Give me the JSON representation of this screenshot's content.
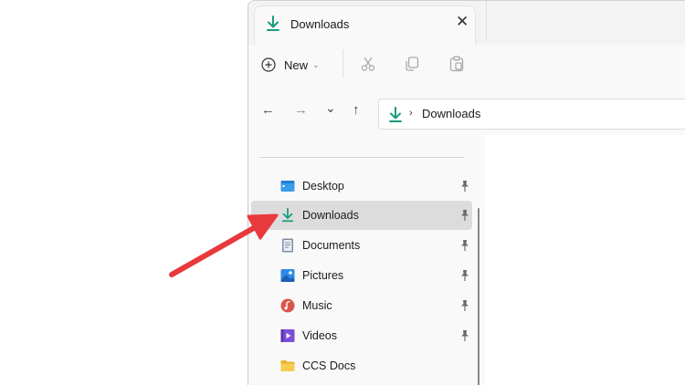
{
  "tab": {
    "title": "Downloads",
    "close_glyph": "✕",
    "icon": "download-icon"
  },
  "toolbar": {
    "new_label": "New",
    "new_chevron": "⌄",
    "icons": [
      "cut-icon",
      "copy-icon",
      "paste-icon"
    ]
  },
  "nav": {
    "back": "←",
    "forward": "→",
    "recent": "⌄",
    "up": "↑",
    "address_chevron": "›",
    "address_text": "Downloads"
  },
  "sidebar": {
    "items": [
      {
        "label": "Desktop",
        "icon": "desktop-icon",
        "pinned": true,
        "selected": false
      },
      {
        "label": "Downloads",
        "icon": "download-icon",
        "pinned": true,
        "selected": true
      },
      {
        "label": "Documents",
        "icon": "documents-icon",
        "pinned": true,
        "selected": false
      },
      {
        "label": "Pictures",
        "icon": "pictures-icon",
        "pinned": true,
        "selected": false
      },
      {
        "label": "Music",
        "icon": "music-icon",
        "pinned": true,
        "selected": false
      },
      {
        "label": "Videos",
        "icon": "videos-icon",
        "pinned": true,
        "selected": false
      },
      {
        "label": "CCS Docs",
        "icon": "folder-icon",
        "pinned": false,
        "selected": false
      }
    ]
  },
  "colors": {
    "accent_green": "#1a9b7b",
    "annotation_arrow": "#e8393c",
    "selected_bg": "#dcdcdc"
  }
}
